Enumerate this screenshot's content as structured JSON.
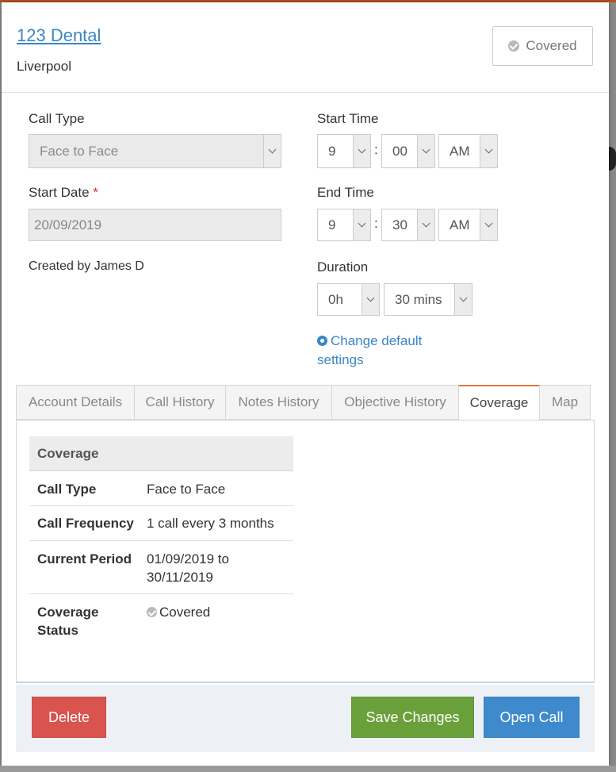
{
  "header": {
    "title": "123 Dental",
    "subtitle": "Liverpool",
    "status_label": "Covered"
  },
  "form": {
    "call_type_label": "Call Type",
    "call_type_value": "Face to Face",
    "start_date_label": "Start Date",
    "start_date_required": "*",
    "start_date_value": "20/09/2019",
    "created_by": "Created by James D",
    "start_time_label": "Start Time",
    "start_hour": "9",
    "start_minute": "00",
    "start_ampm": "AM",
    "end_time_label": "End Time",
    "end_hour": "9",
    "end_minute": "30",
    "end_ampm": "AM",
    "time_separator": ":",
    "duration_label": "Duration",
    "duration_hours": "0h",
    "duration_mins": "30 mins",
    "change_settings_line1": "Change default",
    "change_settings_line2": "settings"
  },
  "tabs": [
    {
      "label": "Account Details"
    },
    {
      "label": "Call History"
    },
    {
      "label": "Notes History"
    },
    {
      "label": "Objective History"
    },
    {
      "label": "Coverage",
      "active": true
    },
    {
      "label": "Map"
    }
  ],
  "coverage": {
    "heading": "Coverage",
    "rows": [
      {
        "key": "Call Type",
        "value": "Face to Face"
      },
      {
        "key": "Call Frequency",
        "value": "1 call every 3 months"
      },
      {
        "key_line1": "Current Period",
        "value_line1": "01/09/2019 to",
        "value_line2": "30/11/2019"
      },
      {
        "key_line1": "Coverage",
        "key_line2": "Status",
        "value": "Covered"
      }
    ]
  },
  "footer": {
    "delete_label": "Delete",
    "save_label": "Save Changes",
    "open_label": "Open Call"
  },
  "colors": {
    "link": "#3a86c8",
    "delete": "#d9534f",
    "save": "#6aa03a",
    "open": "#3e8acc",
    "active_tab_accent": "#e07840"
  },
  "icons": {
    "status": "check-circle-icon",
    "settings": "gear-icon",
    "dropdown": "chevron-down-icon"
  }
}
